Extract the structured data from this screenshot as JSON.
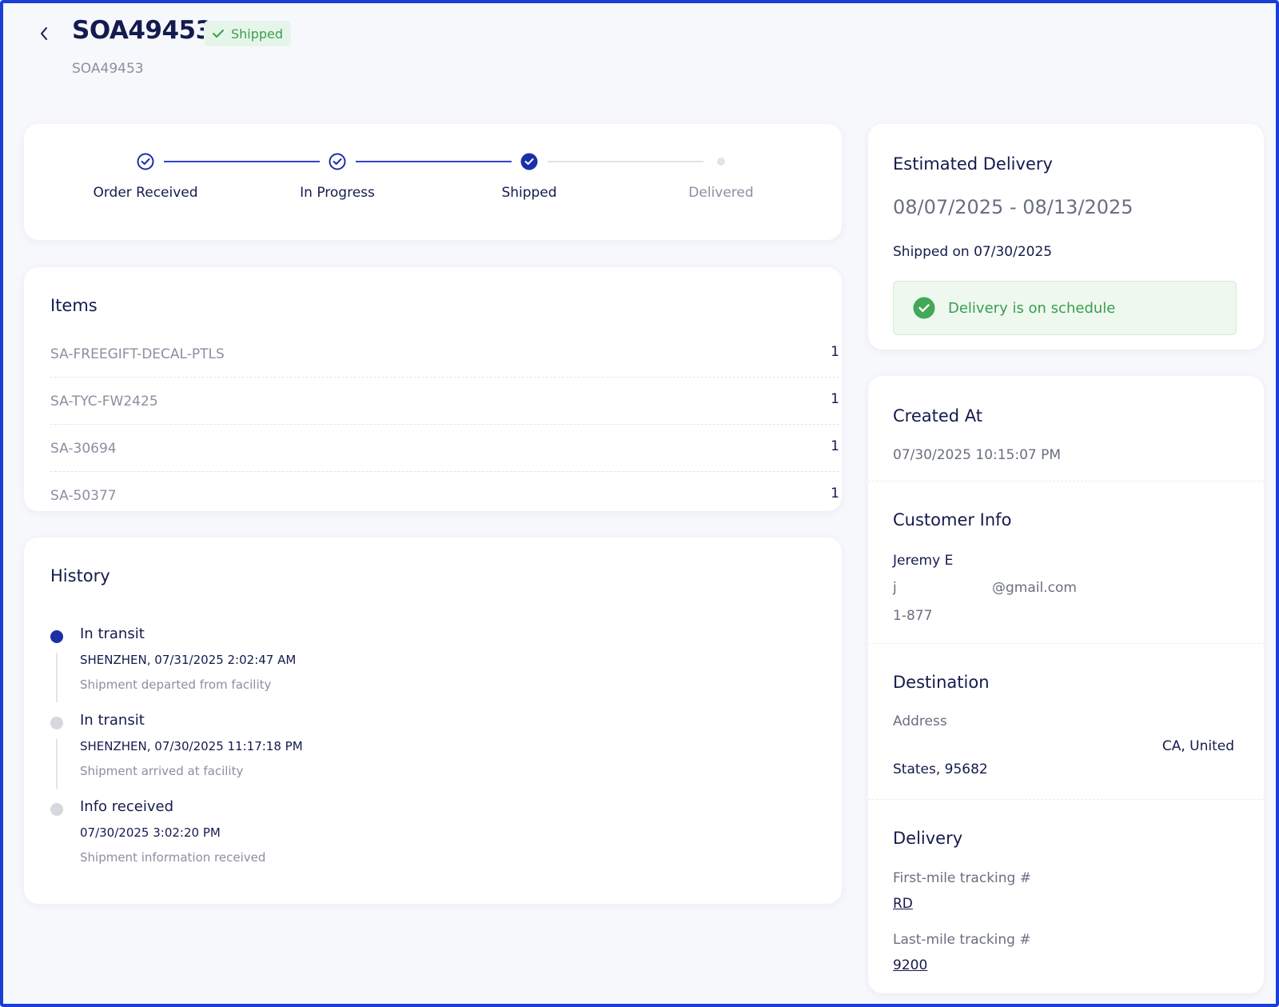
{
  "header": {
    "title": "SOA49453",
    "status": "Shipped",
    "subtitle": "SOA49453"
  },
  "progress": {
    "steps": [
      {
        "label": "Order Received",
        "state": "done"
      },
      {
        "label": "In Progress",
        "state": "done"
      },
      {
        "label": "Shipped",
        "state": "current"
      },
      {
        "label": "Delivered",
        "state": "pending"
      }
    ]
  },
  "items": {
    "heading": "Items",
    "rows": [
      {
        "sku": "SA-FREEGIFT-DECAL-PTLS",
        "qty": "1"
      },
      {
        "sku": "SA-TYC-FW2425",
        "qty": "1"
      },
      {
        "sku": "SA-30694",
        "qty": "1"
      },
      {
        "sku": "SA-50377",
        "qty": "1"
      }
    ]
  },
  "history": {
    "heading": "History",
    "entries": [
      {
        "title": "In transit",
        "where": "SHENZHEN, 07/31/2025 2:02:47 AM",
        "desc": "Shipment departed from facility",
        "active": true
      },
      {
        "title": "In transit",
        "where": "SHENZHEN, 07/30/2025 11:17:18 PM",
        "desc": "Shipment arrived at facility",
        "active": false
      },
      {
        "title": "Info received",
        "where": "07/30/2025 3:02:20 PM",
        "desc": "Shipment information received",
        "active": false
      }
    ]
  },
  "estimate": {
    "heading": "Estimated Delivery",
    "range": "08/07/2025 - 08/13/2025",
    "shipped_on": "Shipped on 07/30/2025",
    "schedule": "Delivery is on schedule"
  },
  "created": {
    "heading": "Created At",
    "value": "07/30/2025 10:15:07 PM"
  },
  "customer": {
    "heading": "Customer Info",
    "name": "Jeremy E",
    "email_start": "j",
    "email_domain": "@gmail.com",
    "phone": "1-877"
  },
  "destination": {
    "heading": "Destination",
    "label": "Address",
    "line1": "CA, United",
    "line2": "States, 95682"
  },
  "delivery": {
    "heading": "Delivery",
    "first_label": "First-mile tracking #",
    "first_value": "RD",
    "last_label": "Last-mile tracking #",
    "last_value": "9200"
  },
  "colors": {
    "accent": "#1c2fa8",
    "success": "#3a9e4f",
    "success_bg": "#e6f5e9",
    "frame": "#1a3fd8"
  },
  "icons": {
    "back": "chevron-left-icon",
    "badge": "check-icon",
    "step_done": "check-circle-outline-icon",
    "step_current": "check-circle-filled-icon",
    "schedule": "check-circle-filled-icon"
  }
}
